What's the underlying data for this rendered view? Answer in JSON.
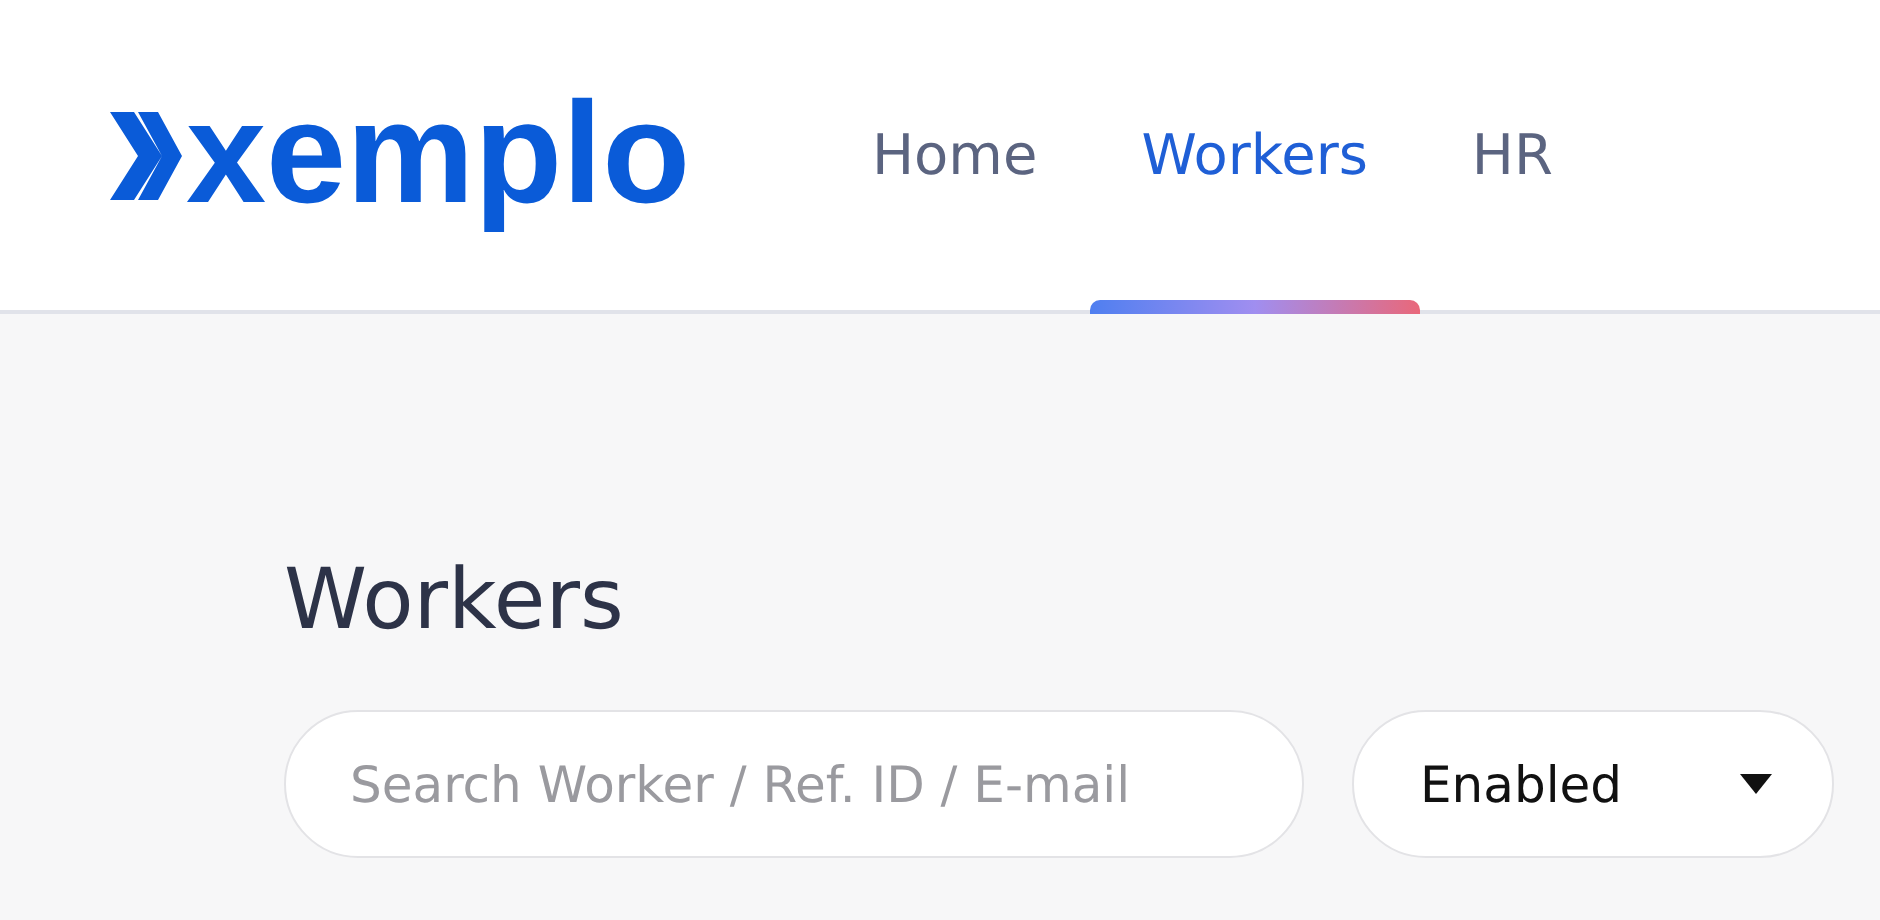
{
  "logo": {
    "text": "xemplo"
  },
  "nav": [
    {
      "label": "Home",
      "selected": false
    },
    {
      "label": "Workers",
      "selected": true
    },
    {
      "label": "HR",
      "selected": false
    }
  ],
  "page_title": "Workers",
  "search": {
    "placeholder": "Search Worker / Ref. ID / E-mail"
  },
  "status_filter": {
    "value": "Enabled"
  }
}
